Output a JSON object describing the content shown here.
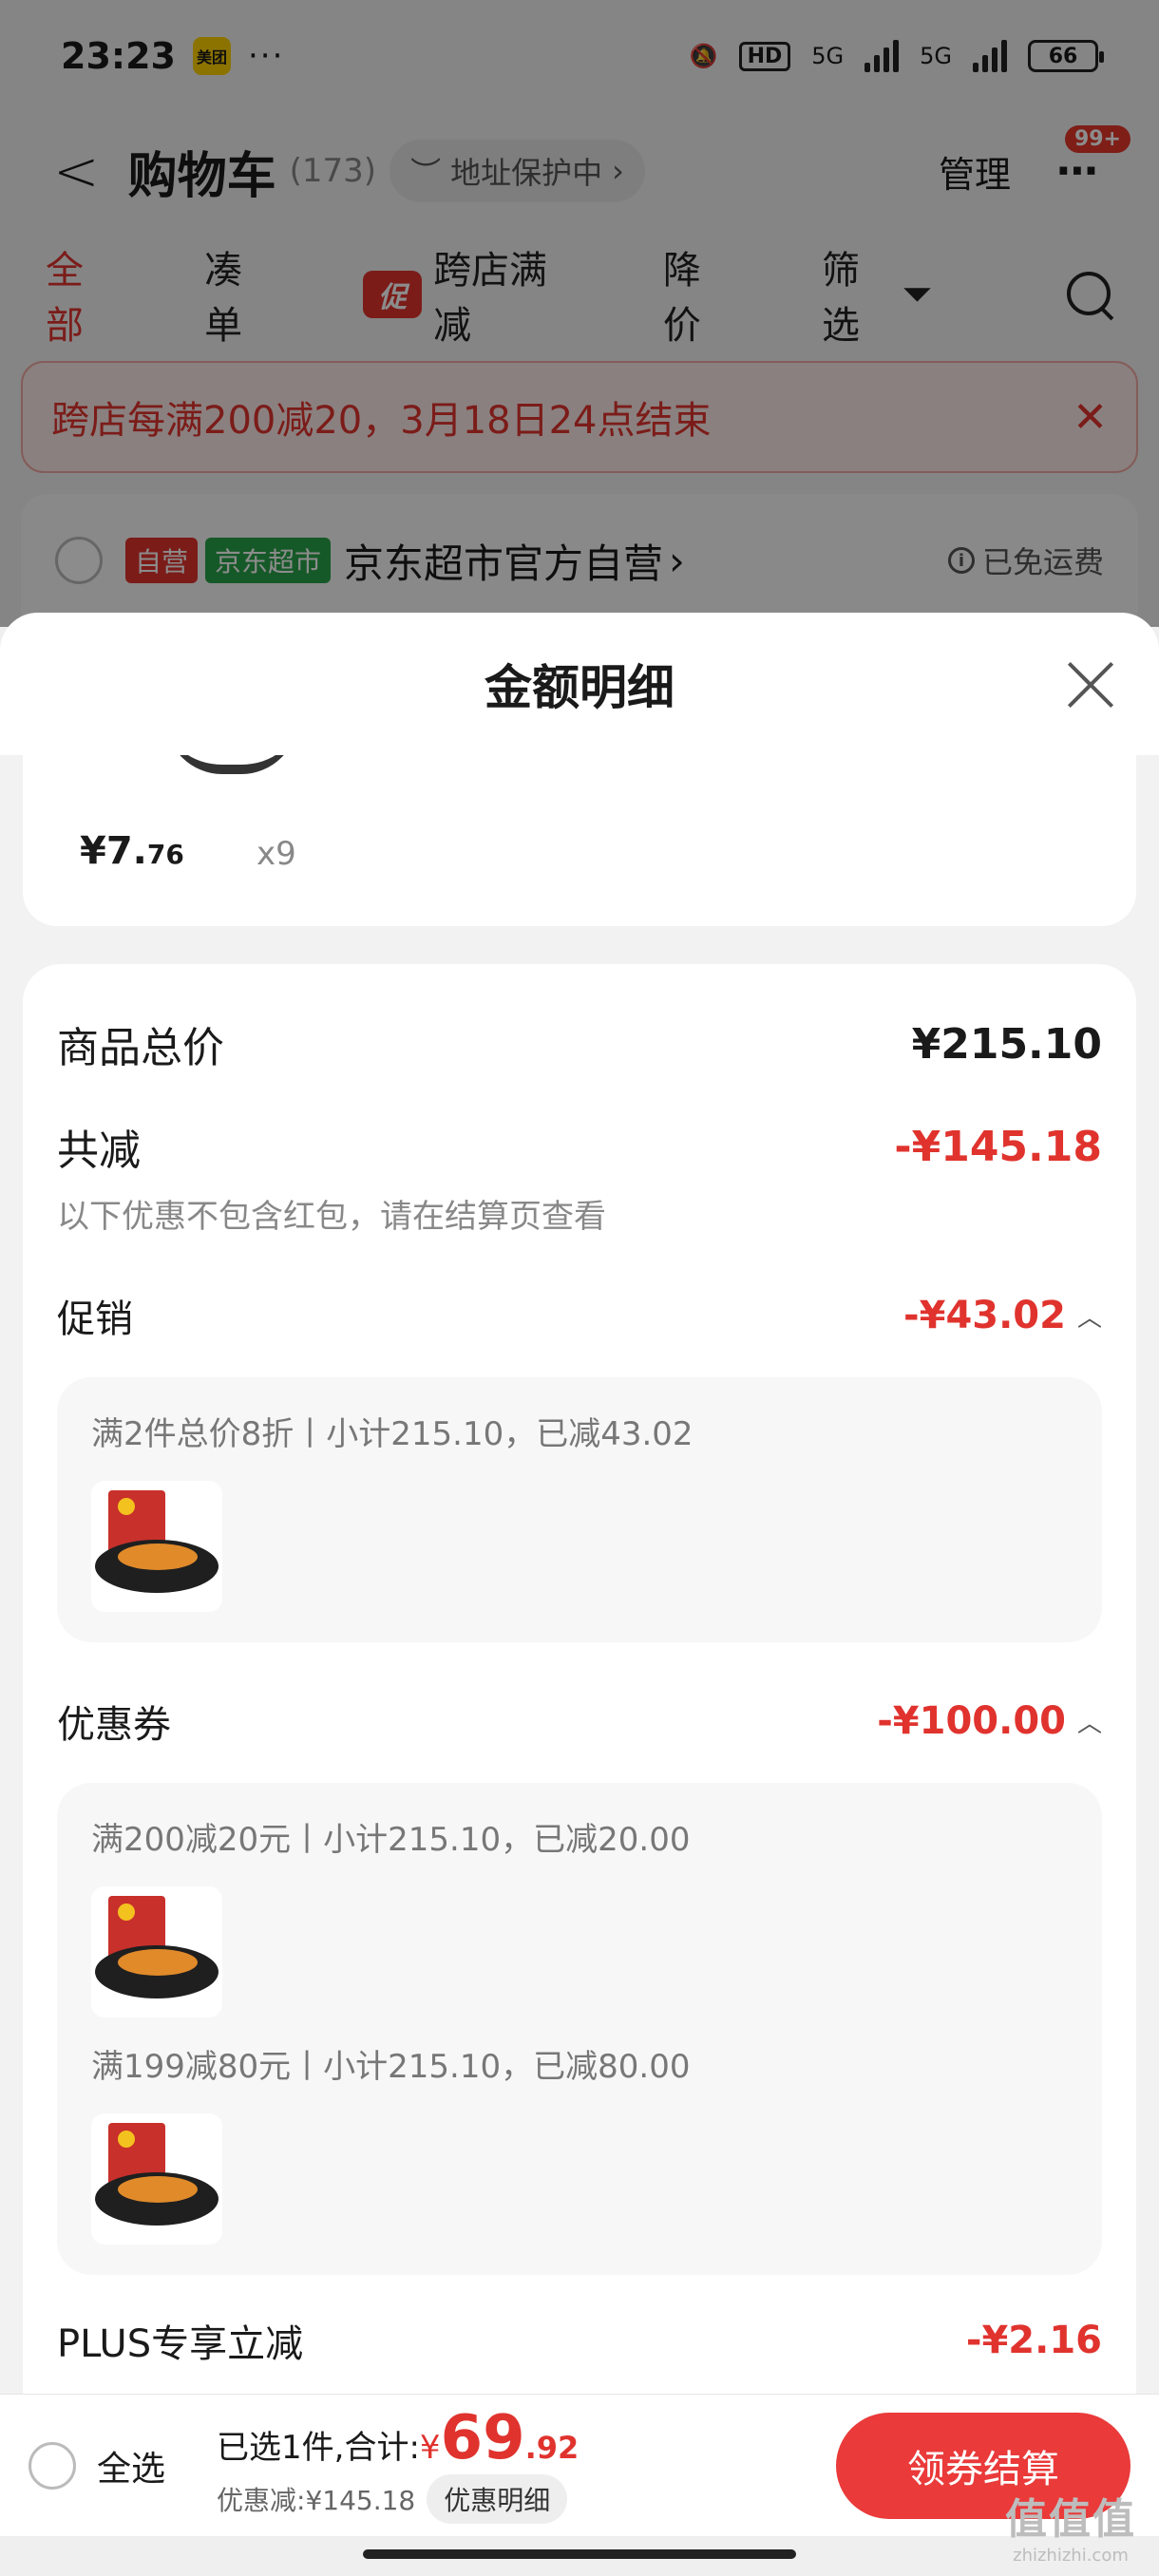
{
  "status": {
    "time": "23:23",
    "app_badge": "美团",
    "dots": "···",
    "hd": "HD",
    "net1": "5G",
    "net2": "5G",
    "battery": "66"
  },
  "nav": {
    "title": "购物车",
    "count": "(173)",
    "address": "地址保护中",
    "manage": "管理",
    "more_badge": "99+"
  },
  "tabs": {
    "all": "全部",
    "combine": "凑单",
    "promo_tag": "促",
    "cross_store": "跨店满减",
    "price_drop": "降价",
    "filter": "筛选"
  },
  "banner": {
    "text": "跨店每满200减20，3月18日24点结束"
  },
  "store": {
    "tag_self": "自营",
    "tag_market": "京东超市",
    "name": "京东超市官方自营",
    "shipping": "已免运费"
  },
  "sheet": {
    "title": "金额明细",
    "item": {
      "price_int": "¥7.",
      "price_dec": "76",
      "qty": "x9"
    },
    "total_label": "商品总价",
    "total_value": "¥215.10",
    "discount_label": "共减",
    "discount_value": "-¥145.18",
    "note": "以下优惠不包含红包，请在结算页查看",
    "promo": {
      "label": "促销",
      "value": "-¥43.02",
      "line": "满2件总价8折丨小计215.10，已减43.02"
    },
    "coupon": {
      "label": "优惠券",
      "value": "-¥100.00",
      "line1": "满200减20元丨小计215.10，已减20.00",
      "line2": "满199减80元丨小计215.10，已减80.00"
    },
    "plus": {
      "label": "PLUS专享立减",
      "value": "-¥2.16"
    }
  },
  "checkout": {
    "select_all": "全选",
    "selected": "已选1件,合计:",
    "yen": "¥",
    "total_int": "69",
    "total_dec": ".92",
    "saved": "优惠减:¥145.18",
    "detail_button": "优惠明细",
    "button": "领券结算"
  },
  "watermark": {
    "main": "值值值",
    "sub": "zhizhizhi.com"
  },
  "colors": {
    "accent_red": "#e0332e",
    "button_red": "#ea3a3a",
    "market_green": "#29a34a"
  }
}
